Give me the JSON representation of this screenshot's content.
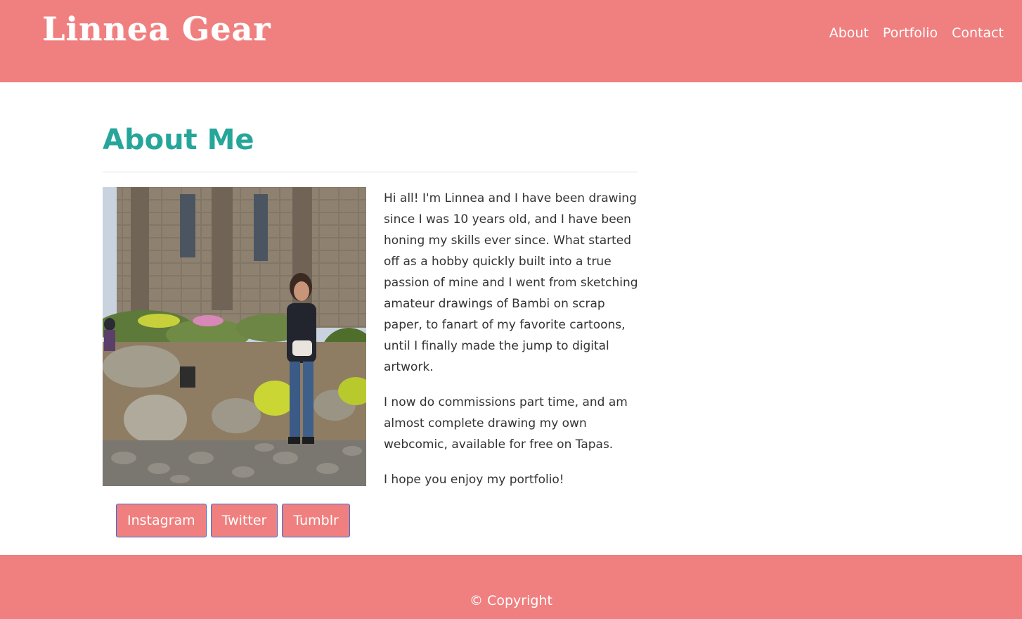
{
  "header": {
    "brand": "Linnea Gear",
    "nav": [
      "About",
      "Portfolio",
      "Contact"
    ],
    "background": "#f07f7f"
  },
  "main": {
    "title": "About Me",
    "title_color": "#26a69a",
    "photo_alt": "Linnea standing in front of a stone castle with a rock garden",
    "bio": [
      "Hi all! I'm Linnea and I have been drawing since I was 10 years old, and I have been honing my skills ever since. What started off as a hobby quickly built into a true passion of mine and I went from sketching amateur drawings of Bambi on scrap paper, to fanart of my favorite cartoons, until I finally made the jump to digital artwork.",
      "I now do commissions part time, and am almost complete drawing my own webcomic, available for free on Tapas.",
      "I hope you enjoy my portfolio!"
    ],
    "social_buttons": [
      "Instagram",
      "Twitter",
      "Tumblr"
    ]
  },
  "footer": {
    "copyright": "© Copyright"
  }
}
